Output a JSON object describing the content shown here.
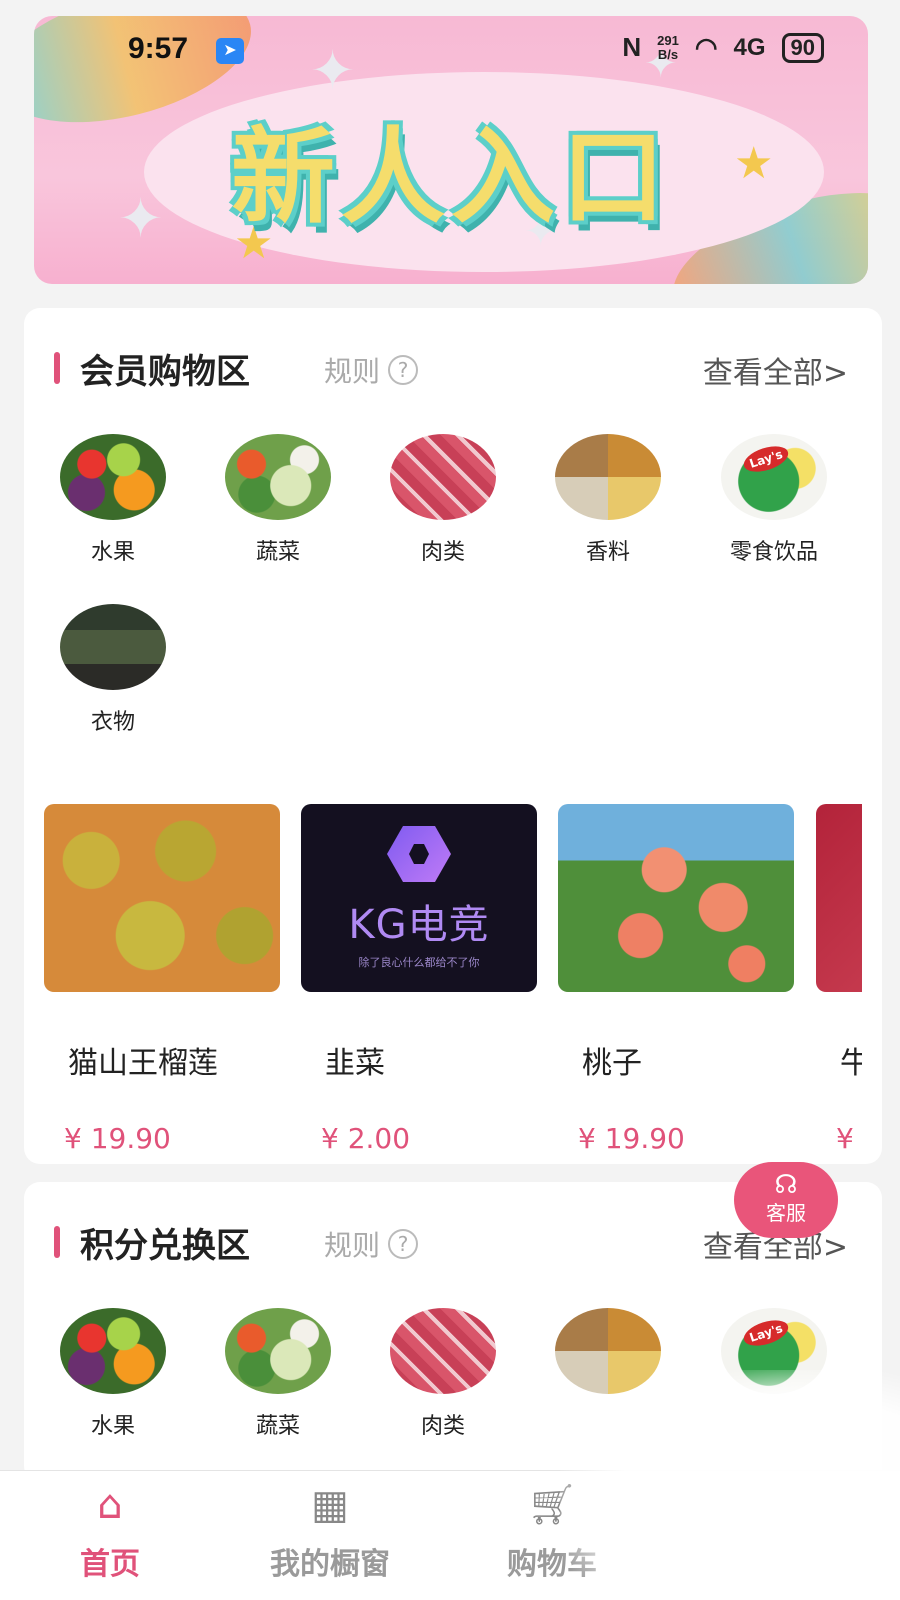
{
  "banner": {
    "title": "新人入口"
  },
  "status_bar": {
    "time": "9:57",
    "app_badge_icon": "feather-icon",
    "nfc": "N",
    "speed_value": "291",
    "speed_unit": "B/s",
    "wifi_icon": "wifi-icon",
    "network": "4G",
    "battery": "90"
  },
  "member_section": {
    "title": "会员购物区",
    "rule_label": "规则",
    "rule_icon": "?",
    "view_all": "查看全部>",
    "categories": [
      {
        "label": "水果",
        "icon": "fruit-thumb"
      },
      {
        "label": "蔬菜",
        "icon": "vegetable-thumb"
      },
      {
        "label": "肉类",
        "icon": "meat-thumb"
      },
      {
        "label": "香料",
        "icon": "spice-thumb"
      },
      {
        "label": "零食饮品",
        "icon": "snack-thumb"
      },
      {
        "label": "衣物",
        "icon": "clothes-thumb"
      }
    ],
    "snack_brand": "Lay's",
    "products": [
      {
        "name": "猫山王榴莲",
        "price": "¥ 19.90"
      },
      {
        "name": "韭菜",
        "price": "¥ 2.00",
        "image_title": "KG电竞",
        "image_subtitle": "除了良心什么都给不了你"
      },
      {
        "name": "桃子",
        "price": "¥ 19.90"
      },
      {
        "name": "牛",
        "price": "¥"
      }
    ]
  },
  "customer_service": {
    "label": "客服",
    "icon": "headset-icon"
  },
  "points_section": {
    "title": "积分兑换区",
    "rule_label": "规则",
    "rule_icon": "?",
    "view_all": "查看全部>",
    "categories": [
      {
        "label": "水果"
      },
      {
        "label": "蔬菜"
      },
      {
        "label": "肉类"
      },
      {
        "label": ""
      },
      {
        "label": ""
      }
    ]
  },
  "bottom_nav": [
    {
      "label": "首页",
      "icon": "home-icon",
      "active": true
    },
    {
      "label": "我的橱窗",
      "icon": "grid-icon",
      "active": false
    },
    {
      "label": "购物车",
      "icon": "cart-icon",
      "active": false
    }
  ],
  "colors": {
    "accent": "#e0527a",
    "background": "#f3f3f3",
    "card": "#ffffff"
  }
}
